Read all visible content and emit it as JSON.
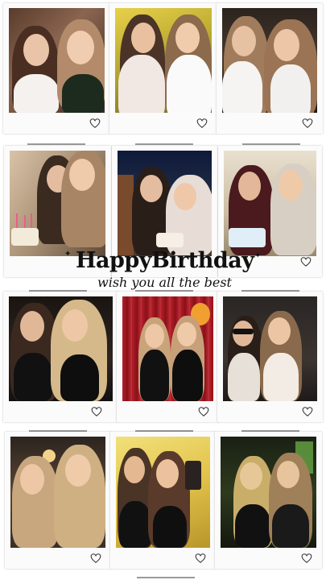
{
  "greeting": {
    "title": "HappyBirthday",
    "subtitle": "wish you all the best"
  },
  "polaroids": [
    {
      "name": "photo-selfie-white-tops",
      "scene": "two friends taking a selfie"
    },
    {
      "name": "photo-white-dresses-garden",
      "scene": "two friends in white dresses"
    },
    {
      "name": "photo-kiss-night-patio",
      "scene": "friend kissing another friend's cheek"
    },
    {
      "name": "photo-birthday-cake-hug",
      "scene": "hug with birthday cake and candles"
    },
    {
      "name": "photo-tiara-cake-night",
      "scene": "birthday girl with tiara and cake"
    },
    {
      "name": "photo-cake-booth",
      "scene": "two friends with blue-frosted cake"
    },
    {
      "name": "photo-black-outfits-dark",
      "scene": "two friends in black outfits"
    },
    {
      "name": "photo-red-curtain-party",
      "scene": "friends in front of red curtains"
    },
    {
      "name": "photo-mirror-selfie-sunglasses",
      "scene": "mirror selfie with sunglasses"
    },
    {
      "name": "photo-kiss-restaurant",
      "scene": "cheek kiss at restaurant"
    },
    {
      "name": "photo-yellow-selfie",
      "scene": "selfie in warm yellow light"
    },
    {
      "name": "photo-kiss-neon-bar",
      "scene": "cheek kiss at neon bar"
    }
  ],
  "icons": {
    "heart": "heart-outline-icon",
    "sparkle": "sparkle-icon"
  },
  "colors": {
    "background": "#ffffff",
    "card": "#fbfbfb",
    "text": "#111111"
  }
}
